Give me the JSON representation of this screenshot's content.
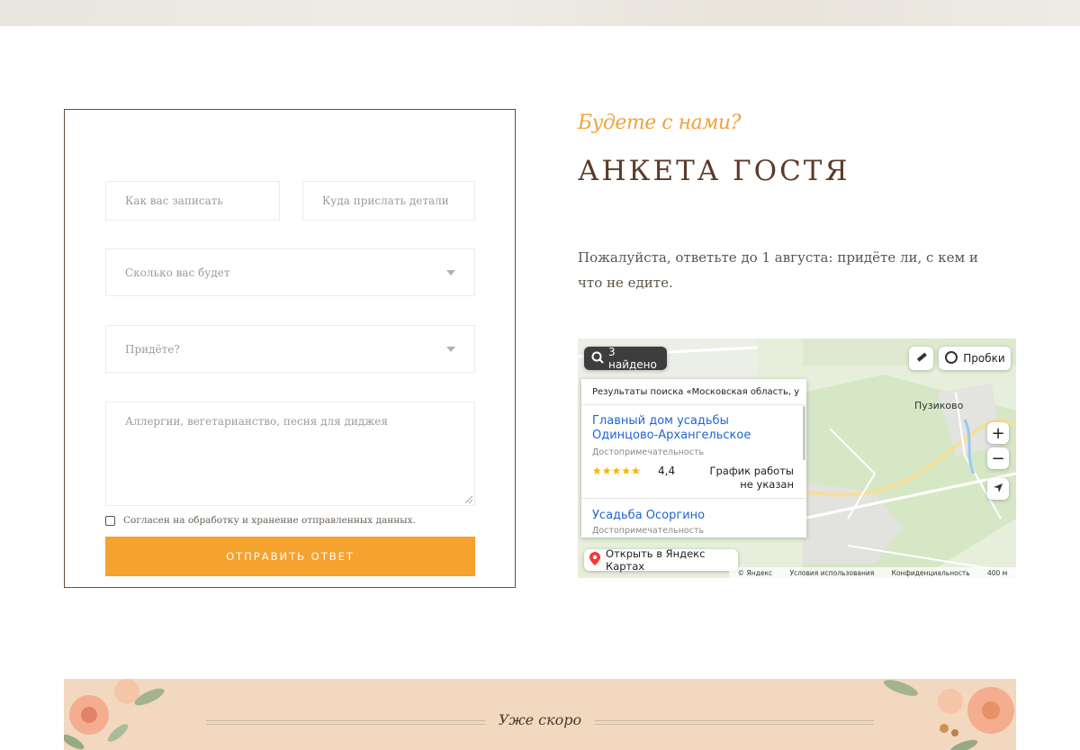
{
  "form": {
    "name_placeholder": "Как вас записать",
    "contact_placeholder": "Куда прислать детали",
    "count_placeholder": "Сколько вас будет",
    "attend_placeholder": "Придёте?",
    "notes_placeholder": "Аллергии, вегетарианство, песня для диджея",
    "consent_label": "Согласен на обработку и хранение отправленных данных.",
    "submit_label": "ОТПРАВИТЬ ОТВЕТ"
  },
  "header": {
    "script_subtitle": "Будете с нами?",
    "title": "АНКЕТА ГОСТЯ",
    "description": "Пожалуйста, ответьте до 1 августа: придёте ли, с кем и что не едите."
  },
  "map": {
    "found_label": "3 найдено",
    "traffic_label": "Пробки",
    "place_label": "Пузиково",
    "results_header": "Результаты поиска «Московская область, усад...",
    "result1_name": "Главный дом усадьбы Одинцово-Архангельское",
    "result1_category": "Достопримечательность",
    "result1_stars": "★★★★★",
    "result1_rating": "4,4",
    "result1_hours": "График работы не указан",
    "result2_name": "Усадьба Осоргино",
    "result2_category": "Достопримечательность",
    "open_label": "Открыть в Яндекс Картах",
    "footer_brand": "© Яндекс",
    "footer_terms": "Условия использования",
    "footer_privacy": "Конфиденциальность",
    "footer_scale": "400 м",
    "zoom_in": "+",
    "zoom_out": "−"
  },
  "banner": {
    "text": "Уже скоро"
  },
  "colors": {
    "accent": "#f5a22e",
    "title": "#5b3b28",
    "banner": "#f1d8bf",
    "link": "#1f64d6"
  }
}
